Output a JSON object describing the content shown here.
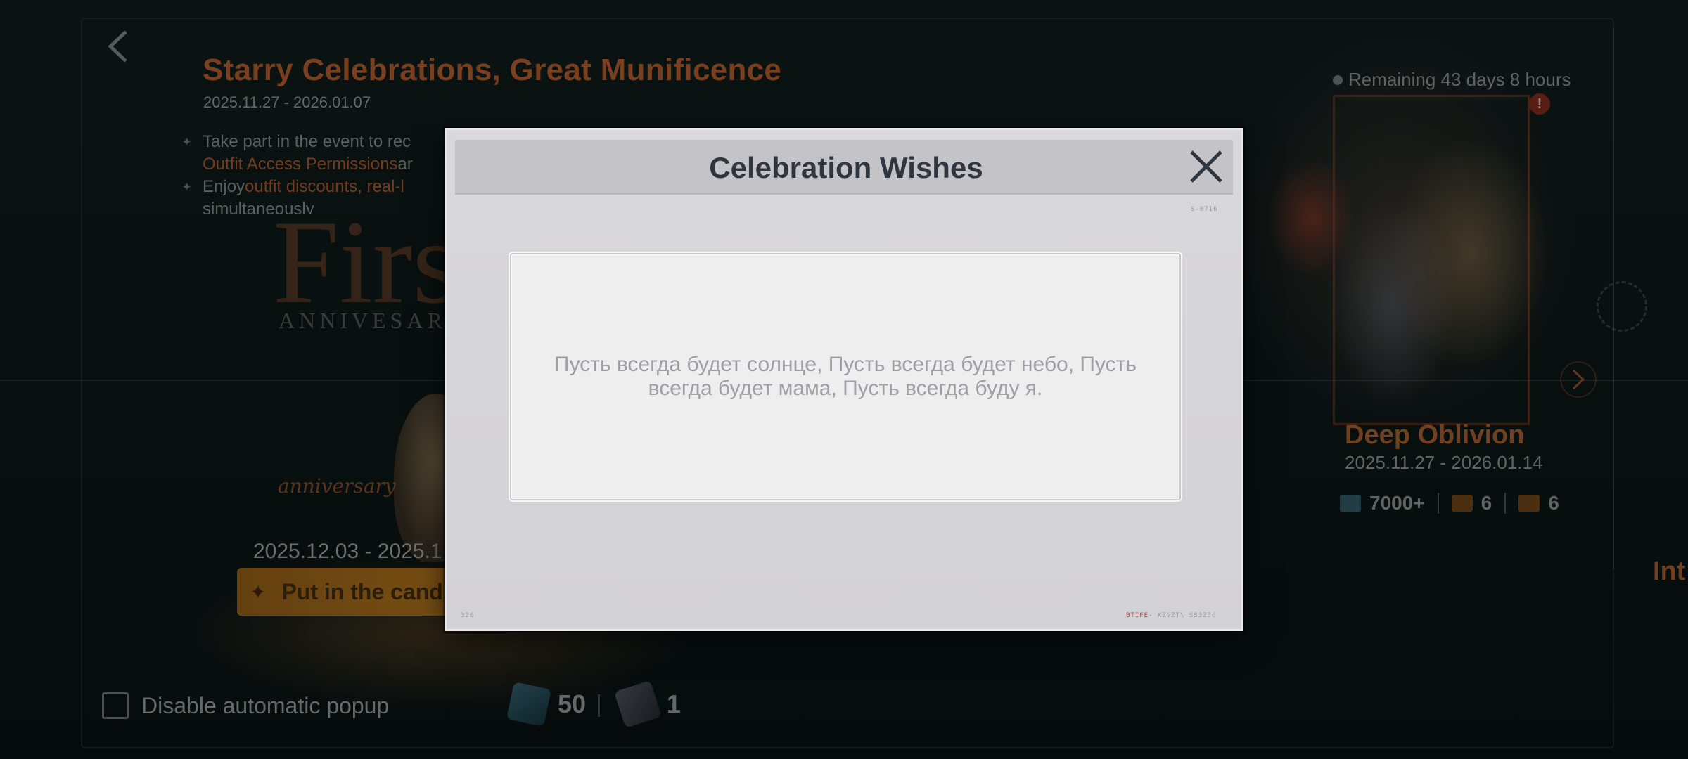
{
  "event": {
    "title": "Starry Celebrations, Great Munificence",
    "dates": "2025.11.27 - 2026.01.07",
    "bullet1_a": "Take part in the event to rec",
    "bullet1_b": "Outfit Access Permissions",
    "bullet1_c": " ar",
    "bullet2_a": "Enjoy ",
    "bullet2_b": "outfit discounts, real-l",
    "bullet2_c": "simultaneously",
    "logo_main": "Firs",
    "logo_sub": "ANNIVESAR",
    "script_text": "anniversary"
  },
  "cake": {
    "dates": "2025.12.03 - 2025.1",
    "button_label": "Put in the cand"
  },
  "footer": {
    "disable_label": "Disable automatic popup",
    "currency1_value": "50",
    "currency2_value": "1"
  },
  "right_panel": {
    "remaining": "Remaining 43 days 8 hours",
    "alert": "!",
    "title": "Deep Oblivion",
    "dates": "2025.11.27 - 2026.01.14",
    "reward1": "7000+",
    "reward2": "6",
    "reward3": "6",
    "next_label": "Int"
  },
  "modal": {
    "title": "Celebration Wishes",
    "message": "Пусть всегда будет солнце, Пусть всегда будет небо, Пусть всегда будет мама, Пусть всегда буду я.",
    "corner_code_1": "S-0716",
    "corner_code_2": "326",
    "footer_code_red": "BTIFE-",
    "footer_code": "KZVZT\\ SS3Z3d"
  },
  "colors": {
    "accent_orange": "#a9582a",
    "modal_bg": "#d9d8dc",
    "title_text": "#2f3640"
  }
}
